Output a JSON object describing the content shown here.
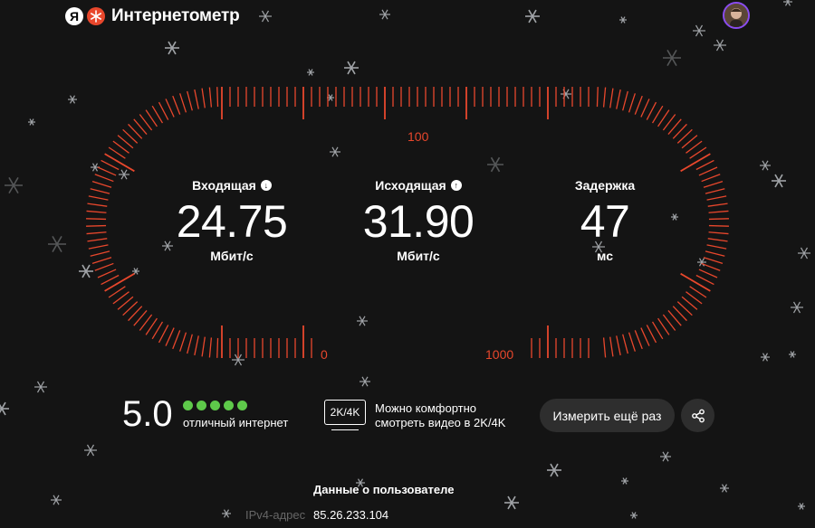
{
  "header": {
    "logo_letter": "Я",
    "brand": "Интернетометр",
    "avatar_icon": "user-avatar"
  },
  "gauge": {
    "scale_100": "100",
    "scale_0": "0",
    "scale_1000": "1000",
    "color": "#e8472c"
  },
  "metrics": {
    "download": {
      "label": "Входящая",
      "value": "24.75",
      "unit": "Мбит/с",
      "icon": "download-arrow-icon"
    },
    "upload": {
      "label": "Исходящая",
      "value": "31.90",
      "unit": "Мбит/с",
      "icon": "upload-arrow-icon"
    },
    "latency": {
      "label": "Задержка",
      "value": "47",
      "unit": "мс"
    }
  },
  "result": {
    "score": "5.0",
    "stars_filled": 5,
    "stars_total": 5,
    "star_color": "#5ec94a",
    "rating_text": "отличный интернет",
    "badge": "2K/4K",
    "description_line1": "Можно комфортно",
    "description_line2": "смотреть видео в 2K/4K",
    "retest_button": "Измерить ещё раз",
    "share_icon": "share-icon"
  },
  "user": {
    "section_title": "Данные о пользователе",
    "ipv4_label": "IPv4-адрес",
    "ipv4_value": "85.26.233.104"
  }
}
